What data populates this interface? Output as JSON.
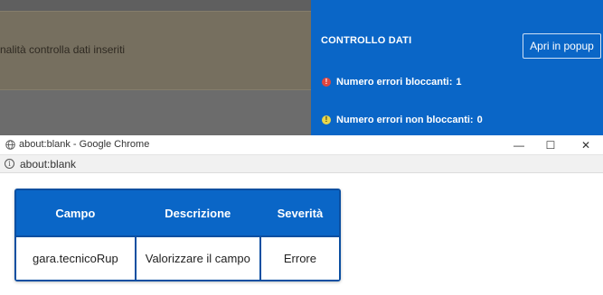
{
  "background_app": {
    "warning_text": "nalità controlla dati inseriti",
    "panel": {
      "title": "CONTROLLO DATI",
      "popup_button_label": "Apri in popup",
      "blocking_label": "Numero errori bloccanti:",
      "blocking_count": "1",
      "nonblocking_label": "Numero errori non bloccanti:",
      "nonblocking_count": "0",
      "icons": {
        "blocking": "error-icon",
        "nonblocking": "warning-icon"
      }
    }
  },
  "chrome": {
    "window_title": "about:blank - Google Chrome",
    "url": "about:blank",
    "controls": {
      "minimize": "—",
      "maximize": "☐",
      "close": "✕"
    }
  },
  "table": {
    "headers": [
      "Campo",
      "Descrizione",
      "Severità"
    ],
    "rows": [
      [
        "gara.tecnicoRup",
        "Valorizzare il campo",
        "Errore"
      ]
    ]
  },
  "colors": {
    "accent_blue": "#0a66c7",
    "table_border": "#0b4fa1",
    "error_red": "#e0463f",
    "warning_yellow": "#e9d64a"
  }
}
